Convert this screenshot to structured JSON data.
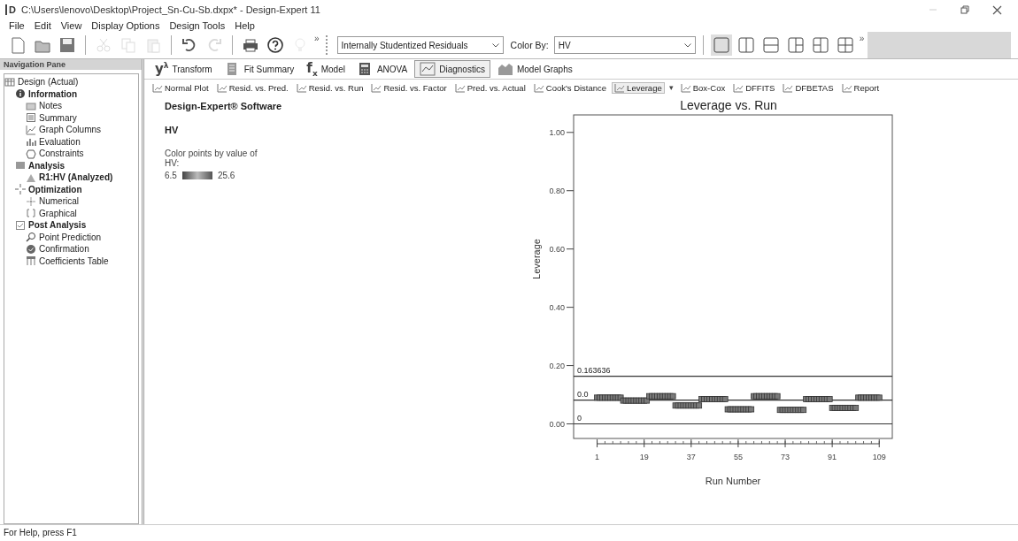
{
  "window": {
    "title": "C:\\Users\\lenovo\\Desktop\\Project_Sn-Cu-Sb.dxpx* - Design-Expert 11",
    "app_mark": "D"
  },
  "menu": [
    "File",
    "Edit",
    "View",
    "Display Options",
    "Design Tools",
    "Help"
  ],
  "toolbar": {
    "buttons": [
      {
        "disabled": false
      },
      {
        "disabled": false
      },
      {
        "disabled": false
      },
      {
        "disabled": true
      },
      {
        "disabled": true
      },
      {
        "disabled": true
      },
      {
        "disabled": false
      },
      {
        "disabled": true
      },
      {
        "disabled": false
      },
      {
        "disabled": false
      },
      {
        "disabled": true
      }
    ],
    "overflow": "»",
    "plot_select": {
      "value": "Internally Studentized Residuals"
    },
    "color_by": {
      "label": "Color By:",
      "value": "HV"
    },
    "layouts": [
      {
        "selected": true
      },
      {
        "selected": false
      },
      {
        "selected": false
      },
      {
        "selected": false
      },
      {
        "selected": false
      },
      {
        "selected": false
      }
    ],
    "layout_overflow": "»"
  },
  "navigation": {
    "title": "Navigation Pane",
    "tree": [
      {
        "label": "Design (Actual)",
        "bold": false,
        "children": [
          {
            "label": "Information",
            "bold": true,
            "children": [
              {
                "label": "Notes",
                "bold": false
              },
              {
                "label": "Summary",
                "bold": false
              },
              {
                "label": "Graph Columns",
                "bold": false
              },
              {
                "label": "Evaluation",
                "bold": false
              },
              {
                "label": "Constraints",
                "bold": false
              }
            ]
          },
          {
            "label": "Analysis",
            "bold": true,
            "children": [
              {
                "label": "R1:HV (Analyzed)",
                "bold": true
              }
            ]
          },
          {
            "label": "Optimization",
            "bold": true,
            "children": [
              {
                "label": "Numerical",
                "bold": false
              },
              {
                "label": "Graphical",
                "bold": false
              }
            ]
          },
          {
            "label": "Post Analysis",
            "bold": true,
            "children": [
              {
                "label": "Point Prediction",
                "bold": false
              },
              {
                "label": "Confirmation",
                "bold": false
              },
              {
                "label": "Coefficients Table",
                "bold": false
              }
            ]
          }
        ]
      }
    ]
  },
  "tabs": [
    {
      "icon_text": "y$^{λ}$",
      "label": "Transform",
      "selected": false
    },
    {
      "label": "Fit Summary",
      "selected": false
    },
    {
      "icon_text": "f$_{x}$",
      "label": "Model",
      "selected": false
    },
    {
      "label": "ANOVA",
      "selected": false
    },
    {
      "label": "Diagnostics",
      "selected": true
    },
    {
      "label": "Model Graphs",
      "selected": false
    }
  ],
  "subtabs": [
    {
      "kind": "tab",
      "label": "Normal Plot",
      "selected": false
    },
    {
      "kind": "tab",
      "label": "Resid. vs. Pred.",
      "selected": false
    },
    {
      "kind": "tab",
      "label": "Resid. vs. Run",
      "selected": false
    },
    {
      "kind": "tab",
      "label": "Resid. vs. Factor",
      "selected": false
    },
    {
      "kind": "tab",
      "label": "Pred. vs. Actual",
      "selected": false
    },
    {
      "kind": "tab",
      "label": "Cook's Distance",
      "selected": false
    },
    {
      "kind": "tab",
      "label": "Leverage",
      "selected": true
    },
    {
      "kind": "menu",
      "label": "▾"
    },
    {
      "kind": "tab",
      "label": "Box-Cox",
      "selected": false
    },
    {
      "kind": "tab",
      "label": "DFFITS",
      "selected": false
    },
    {
      "kind": "tab",
      "label": "DFBETAS",
      "selected": false
    },
    {
      "kind": "tab",
      "label": "Report",
      "selected": false
    }
  ],
  "info": {
    "heading": "Design-Expert® Software",
    "response": "HV",
    "legend_title": "Color points by value of",
    "legend_name": "HV:",
    "legend_low": "6.5",
    "legend_high": "25.6"
  },
  "plot": {
    "chart_data": {
      "type": "scatter",
      "title": "Leverage vs. Run",
      "xlabel": "Run Number",
      "ylabel": "Leverage",
      "x": [
        1,
        2,
        3,
        4,
        5,
        6,
        7,
        8,
        9,
        10,
        11,
        12,
        13,
        14,
        15,
        16,
        17,
        18,
        19,
        20,
        21,
        22,
        23,
        24,
        25,
        26,
        27,
        28,
        29,
        30,
        31,
        32,
        33,
        34,
        35,
        36,
        37,
        38,
        39,
        40,
        41,
        42,
        43,
        44,
        45,
        46,
        47,
        48,
        49,
        50,
        51,
        52,
        53,
        54,
        55,
        56,
        57,
        58,
        59,
        60,
        61,
        62,
        63,
        64,
        65,
        66,
        67,
        68,
        69,
        70,
        71,
        72,
        73,
        74,
        75,
        76,
        77,
        78,
        79,
        80,
        81,
        82,
        83,
        84,
        85,
        86,
        87,
        88,
        89,
        90,
        91,
        92,
        93,
        94,
        95,
        96,
        97,
        98,
        99,
        100,
        101,
        102,
        103,
        104,
        105,
        106,
        107,
        108,
        109
      ],
      "series": [
        {
          "color": "#7a7a7a",
          "values": [
            0.09,
            0.09,
            0.09,
            0.09,
            0.09,
            0.09,
            0.09,
            0.09,
            0.09,
            0.09,
            0.08,
            0.08,
            0.08,
            0.08,
            0.08,
            0.08,
            0.08,
            0.08,
            0.08,
            0.08,
            0.095,
            0.095,
            0.095,
            0.095,
            0.095,
            0.095,
            0.095,
            0.095,
            0.095,
            0.095,
            0.063,
            0.063,
            0.063,
            0.063,
            0.063,
            0.063,
            0.063,
            0.063,
            0.063,
            0.063,
            0.085,
            0.085,
            0.085,
            0.085,
            0.085,
            0.085,
            0.085,
            0.085,
            0.085,
            0.085,
            0.05,
            0.05,
            0.05,
            0.05,
            0.05,
            0.05,
            0.05,
            0.05,
            0.05,
            0.05,
            0.095,
            0.095,
            0.095,
            0.095,
            0.095,
            0.095,
            0.095,
            0.095,
            0.095,
            0.095,
            0.048,
            0.048,
            0.048,
            0.048,
            0.048,
            0.048,
            0.048,
            0.048,
            0.048,
            0.048,
            0.085,
            0.085,
            0.085,
            0.085,
            0.085,
            0.085,
            0.085,
            0.085,
            0.085,
            0.085,
            0.055,
            0.055,
            0.055,
            0.055,
            0.055,
            0.055,
            0.055,
            0.055,
            0.055,
            0.055,
            0.09,
            0.09,
            0.09,
            0.09,
            0.09,
            0.09,
            0.09,
            0.09,
            0.09
          ]
        }
      ],
      "xlim": [
        -8,
        114
      ],
      "ylim": [
        -0.05,
        1.06
      ],
      "xticks": [
        1,
        19,
        37,
        55,
        73,
        91,
        109
      ],
      "yticks": [
        {
          "value": 0,
          "label": "0.00"
        },
        {
          "value": 0.2,
          "label": "0.20"
        },
        {
          "value": 0.4,
          "label": "0.40"
        },
        {
          "value": 0.6,
          "label": "0.60"
        },
        {
          "value": 0.8,
          "label": "0.80"
        },
        {
          "value": 1,
          "label": "1.00"
        }
      ],
      "ref_lines": [
        {
          "axis": "y",
          "value": 0.163636,
          "label": "0.163636"
        },
        {
          "axis": "y",
          "value": 0.0818182
        },
        {
          "axis": "y",
          "value": 0,
          "label": "0"
        }
      ]
    },
    "mean_line_label": "0.0"
  },
  "status_bar": "For Help, press F1"
}
